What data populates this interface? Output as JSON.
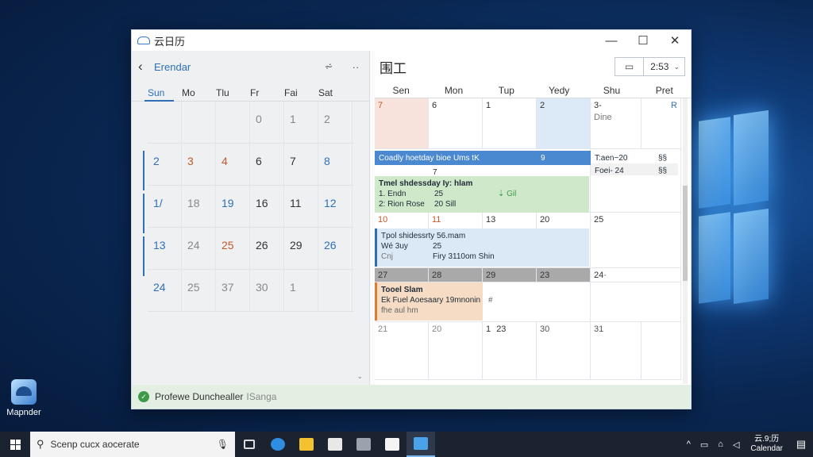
{
  "window": {
    "title": "云日历",
    "minimize": "—",
    "maximize": "☐",
    "close": "✕"
  },
  "sidebar": {
    "back": "‹",
    "calendar_name": "Erendar",
    "tool_filter": "⩫",
    "tool_more": "··",
    "weekdays": [
      "Sun",
      "Mo",
      "Tlu",
      "Fr",
      "Fai",
      "Sat"
    ],
    "rows": [
      [
        "",
        "",
        "",
        "0",
        "1",
        "2"
      ],
      [
        "2",
        "3",
        "4",
        "6",
        "7",
        "8"
      ],
      [
        "1/",
        "18",
        "19",
        "16",
        "11",
        "12"
      ],
      [
        "13",
        "24",
        "25",
        "26",
        "29",
        "26"
      ],
      [
        "24",
        "25",
        "37",
        "30",
        "1",
        ""
      ]
    ],
    "scroll_down": "⌄"
  },
  "main": {
    "title": "围工",
    "view_icon": "▭",
    "time": "2:53",
    "dropdown": "⌄",
    "weekdays": [
      "Sen",
      "Mon",
      "Tup",
      "Yedy",
      "Shu",
      "Pret"
    ],
    "dates": {
      "r1": [
        "7",
        "6",
        "1",
        "2",
        "3‑",
        "R"
      ],
      "r1_note": "Dine",
      "r3": [
        "10",
        "11",
        "13",
        "20",
        "25"
      ],
      "r4": [
        "27",
        "28",
        "29",
        "23",
        "24·"
      ],
      "r5": [
        "21",
        "20",
        "1",
        "23",
        "30",
        "31"
      ]
    },
    "events": {
      "blue_bar": "Coadly hoetday bioe Ums tK",
      "blue_bar_num": "9",
      "side_1": "T:aen~20",
      "side_1b": "§§",
      "side_2": "Foei- 24",
      "side_2b": "§§",
      "sub_num": "7",
      "green_title": "Tmel shdessday Iy: hlam",
      "green_l1a": "1. Endn",
      "green_l1b": "25",
      "green_l1c": "⇣ Gil",
      "green_l2a": "2: Rion Rose",
      "green_l2b": "20 Sill",
      "lb_title": "Tpol shidessrty 56.mam",
      "lb_l1a": "Wé 3uy",
      "lb_l1b": "25",
      "lb_l2a": "Cnj",
      "lb_l2b": "Firy 3110om Shin",
      "or_title": "Tooel Slam",
      "or_l1": "Ek Fuel Aoesaary 19mnonin",
      "or_l1b": "#",
      "or_l2": "fhe aul hm"
    }
  },
  "status_bar": {
    "text": "Profewe Dunchealler",
    "sub": "ISanga"
  },
  "desktop": {
    "icon_label": "Mapnder"
  },
  "taskbar": {
    "search_placeholder": "Scenp cucx aocerate",
    "tray_up": "^",
    "clock_top": "云.9;历",
    "clock_bottom": "Calendar"
  }
}
